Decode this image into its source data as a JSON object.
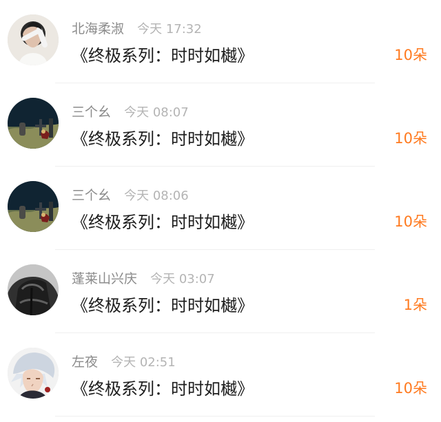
{
  "records": [
    {
      "name": "北海柔淑",
      "time": "今天 17:32",
      "message": "《终极系列：时时如樾》",
      "amount": "10朵",
      "avatar_icon": "person-covering-face-avatar"
    },
    {
      "name": "三个幺",
      "time": "今天 08:07",
      "message": "《终极系列：时时如樾》",
      "amount": "10朵",
      "avatar_icon": "graveyard-night-avatar"
    },
    {
      "name": "三个幺",
      "time": "今天 08:06",
      "message": "《终极系列：时时如樾》",
      "amount": "10朵",
      "avatar_icon": "graveyard-night-avatar"
    },
    {
      "name": "蓬莱山兴庆",
      "time": "今天 03:07",
      "message": "《终极系列：时时如樾》",
      "amount": "1朵",
      "avatar_icon": "dark-jacket-person-avatar"
    },
    {
      "name": "左夜",
      "time": "今天 02:51",
      "message": "《终极系列：时时如樾》",
      "amount": "10朵",
      "avatar_icon": "white-hair-anime-avatar"
    }
  ],
  "colors": {
    "name": "#8b8b8b",
    "time": "#b4b4b4",
    "message": "#1d1d1d",
    "amount": "#ff7a1f",
    "divider": "#efefef"
  }
}
